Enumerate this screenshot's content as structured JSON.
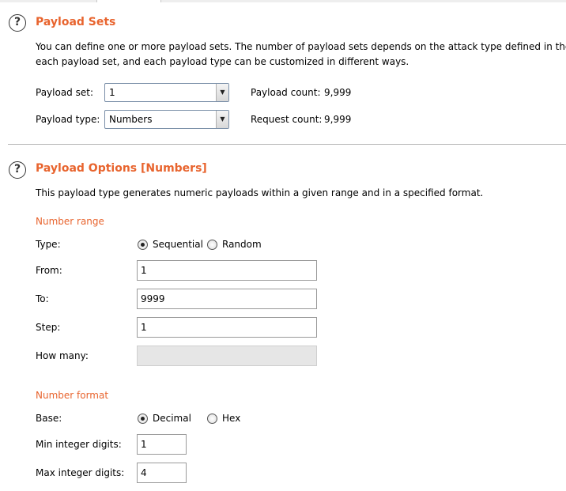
{
  "payload_sets": {
    "title": "Payload Sets",
    "description_line1": "You can define one or more payload sets. The number of payload sets depends on the attack type defined in the Po",
    "description_line2": "each payload set, and each payload type can be customized in different ways.",
    "payload_set_label": "Payload set:",
    "payload_set_value": "1",
    "payload_type_label": "Payload type:",
    "payload_type_value": "Numbers",
    "payload_count_label": "Payload count:",
    "payload_count_value": "9,999",
    "request_count_label": "Request count:",
    "request_count_value": "9,999"
  },
  "payload_options": {
    "title": "Payload Options [Numbers]",
    "description": "This payload type generates numeric payloads within a given range and in a specified format.",
    "number_range": {
      "heading": "Number range",
      "type_label": "Type:",
      "type_options": [
        {
          "label": "Sequential",
          "checked": true
        },
        {
          "label": "Random",
          "checked": false
        }
      ],
      "from_label": "From:",
      "from_value": "1",
      "to_label": "To:",
      "to_value": "9999",
      "step_label": "Step:",
      "step_value": "1",
      "how_many_label": "How many:",
      "how_many_value": ""
    },
    "number_format": {
      "heading": "Number format",
      "base_label": "Base:",
      "base_options": [
        {
          "label": "Decimal",
          "checked": true
        },
        {
          "label": "Hex",
          "checked": false
        }
      ],
      "min_integer_label": "Min integer digits:",
      "min_integer_value": "1",
      "max_integer_label": "Max integer digits:",
      "max_integer_value": "4"
    }
  },
  "icons": {
    "help": "?",
    "dropdown_arrow": "▼"
  },
  "colors": {
    "accent": "#e8642e",
    "divider": "#b5b5b5",
    "disabled_field": "#e6e6e6"
  }
}
